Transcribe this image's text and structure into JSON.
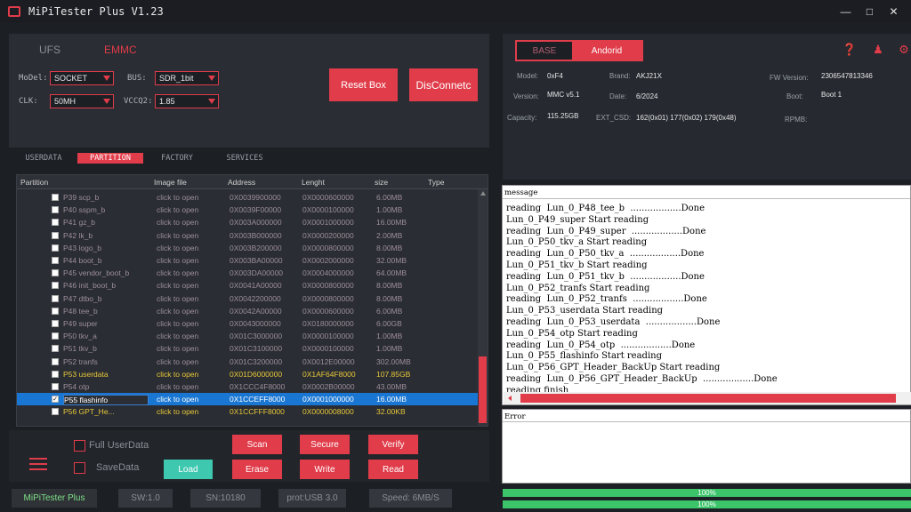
{
  "window": {
    "title": "MiPiTester Plus V1.23",
    "minimize_icon": "minimize-icon",
    "maximize_icon": "maximize-icon",
    "close_icon": "close-icon"
  },
  "top_tabs": [
    "UFS",
    "EMMC"
  ],
  "config": {
    "model_label": "MoDel:",
    "model_value": "SOCKET",
    "bus_label": "BUS:",
    "bus_value": "SDR_1bit",
    "clk_label": "CLK:",
    "clk_value": "50MH",
    "vccq2_label": "VCCQ2:",
    "vccq2_value": "1.85"
  },
  "buttons": {
    "reset": "Reset Box",
    "disconnect": "DisConnetc"
  },
  "sub_tabs": [
    "USERDATA",
    "PARTITION",
    "FACTORY",
    "SERVICES"
  ],
  "table": {
    "headers": [
      "Partition",
      "Image file",
      "Address",
      "Lenght",
      "size",
      "Type"
    ],
    "rows": [
      {
        "name": "P39 scp_b",
        "img": "click to open",
        "addr": "0X0039900000",
        "len": "0X0000600000",
        "size": "6.00MB",
        "checked": false,
        "state": "normal"
      },
      {
        "name": "P40 sspm_b",
        "img": "click to open",
        "addr": "0X0039F00000",
        "len": "0X0000100000",
        "size": "1.00MB",
        "checked": false,
        "state": "normal"
      },
      {
        "name": "P41 gz_b",
        "img": "click to open",
        "addr": "0X003A000000",
        "len": "0X0001000000",
        "size": "16.00MB",
        "checked": false,
        "state": "normal"
      },
      {
        "name": "P42 lk_b",
        "img": "click to open",
        "addr": "0X003B000000",
        "len": "0X0000200000",
        "size": "2.00MB",
        "checked": false,
        "state": "normal"
      },
      {
        "name": "P43 logo_b",
        "img": "click to open",
        "addr": "0X003B200000",
        "len": "0X0000800000",
        "size": "8.00MB",
        "checked": false,
        "state": "normal"
      },
      {
        "name": "P44 boot_b",
        "img": "click to open",
        "addr": "0X003BA00000",
        "len": "0X0002000000",
        "size": "32.00MB",
        "checked": false,
        "state": "normal"
      },
      {
        "name": "P45 vendor_boot_b",
        "img": "click to open",
        "addr": "0X003DA00000",
        "len": "0X0004000000",
        "size": "64.00MB",
        "checked": false,
        "state": "normal"
      },
      {
        "name": "P46 init_boot_b",
        "img": "click to open",
        "addr": "0X0041A00000",
        "len": "0X0000800000",
        "size": "8.00MB",
        "checked": false,
        "state": "normal"
      },
      {
        "name": "P47 dtbo_b",
        "img": "click to open",
        "addr": "0X0042200000",
        "len": "0X0000800000",
        "size": "8.00MB",
        "checked": false,
        "state": "normal"
      },
      {
        "name": "P48 tee_b",
        "img": "click to open",
        "addr": "0X0042A00000",
        "len": "0X0000600000",
        "size": "6.00MB",
        "checked": false,
        "state": "normal"
      },
      {
        "name": "P49 super",
        "img": "click to open",
        "addr": "0X0043000000",
        "len": "0X0180000000",
        "size": "6.00GB",
        "checked": false,
        "state": "normal"
      },
      {
        "name": "P50 tkv_a",
        "img": "click to open",
        "addr": "0X01C3000000",
        "len": "0X0000100000",
        "size": "1.00MB",
        "checked": false,
        "state": "normal"
      },
      {
        "name": "P51 tkv_b",
        "img": "click to open",
        "addr": "0X01C3100000",
        "len": "0X0000100000",
        "size": "1.00MB",
        "checked": false,
        "state": "normal"
      },
      {
        "name": "P52 tranfs",
        "img": "click to open",
        "addr": "0X01C3200000",
        "len": "0X0012E00000",
        "size": "302.00MB",
        "checked": false,
        "state": "normal"
      },
      {
        "name": "P53 userdata",
        "img": "click to open",
        "addr": "0X01D6000000",
        "len": "0X1AF64F8000",
        "size": "107.85GB",
        "checked": false,
        "state": "highlight"
      },
      {
        "name": "P54 otp",
        "img": "click to open",
        "addr": "0X1CCC4F8000",
        "len": "0X0002B00000",
        "size": "43.00MB",
        "checked": false,
        "state": "normal"
      },
      {
        "name": "P55 flashinfo",
        "img": "click to open",
        "addr": "0X1CCEFF8000",
        "len": "0X0001000000",
        "size": "16.00MB",
        "checked": true,
        "state": "selected"
      },
      {
        "name": "P56 GPT_He...",
        "img": "click to open",
        "addr": "0X1CCFFF8000",
        "len": "0X0000008000",
        "size": "32.00KB",
        "checked": false,
        "state": "highlight"
      }
    ]
  },
  "options": {
    "full_userdata": "Full UserData",
    "save_data": "SaveData"
  },
  "actions": {
    "scan": "Scan",
    "secure": "Secure",
    "verify": "Verify",
    "erase": "Erase",
    "write": "Write",
    "read": "Read",
    "load": "Load"
  },
  "status": {
    "brand": "MiPiTester Plus",
    "sw": "SW:1.0",
    "sn": "SN:10180",
    "prot": "prot:USB 3.0",
    "speed": "Speed: 6MB/S"
  },
  "mode": {
    "base": "BASE",
    "android": "Andorid"
  },
  "icons": [
    "help-icon",
    "user-icon",
    "gear-icon"
  ],
  "device": {
    "model_label": "Model:",
    "model": "0xF4",
    "brand_label": "Brand:",
    "brand": "AKJ21X",
    "fw_label": "FW Version:",
    "fw": "2306547813346",
    "version_label": "Version:",
    "version": "MMC v5.1",
    "date_label": "Date:",
    "date": "6/2024",
    "boot_label": "Boot:",
    "boot": "Boot 1",
    "capacity_label": "Capacity:",
    "capacity": "115.25GB",
    "extcsd_label": "EXT_CSD:",
    "extcsd": "162(0x01) 177(0x02) 179(0x48)",
    "rpmb_label": "RPMB:"
  },
  "message": {
    "header": "message",
    "lines": [
      "reading  Lun_0_P48_tee_b  ..................Done",
      "Lun_0_P49_super Start reading",
      "reading  Lun_0_P49_super  ..................Done",
      "Lun_0_P50_tkv_a Start reading",
      "reading  Lun_0_P50_tkv_a  ..................Done",
      "Lun_0_P51_tkv_b Start reading",
      "reading  Lun_0_P51_tkv_b  ..................Done",
      "Lun_0_P52_tranfs Start reading",
      "reading  Lun_0_P52_tranfs  ..................Done",
      "Lun_0_P53_userdata Start reading",
      "reading  Lun_0_P53_userdata  ..................Done",
      "Lun_0_P54_otp Start reading",
      "reading  Lun_0_P54_otp  ..................Done",
      "Lun_0_P55_flashinfo Start reading",
      "Lun_0_P56_GPT_Header_BackUp Start reading",
      "reading  Lun_0_P56_GPT_Header_BackUp  ..................Done",
      "reading finish"
    ]
  },
  "error": {
    "header": "Error"
  },
  "progress": [
    {
      "label": "100%",
      "value": 1.0
    },
    {
      "label": "100%",
      "value": 1.0
    }
  ],
  "colors": {
    "accent": "#e03c4a",
    "load": "#3ec8b0",
    "progress": "#3cc46a",
    "selected_row": "#1976d2",
    "highlight_text": "#e8c83a"
  }
}
